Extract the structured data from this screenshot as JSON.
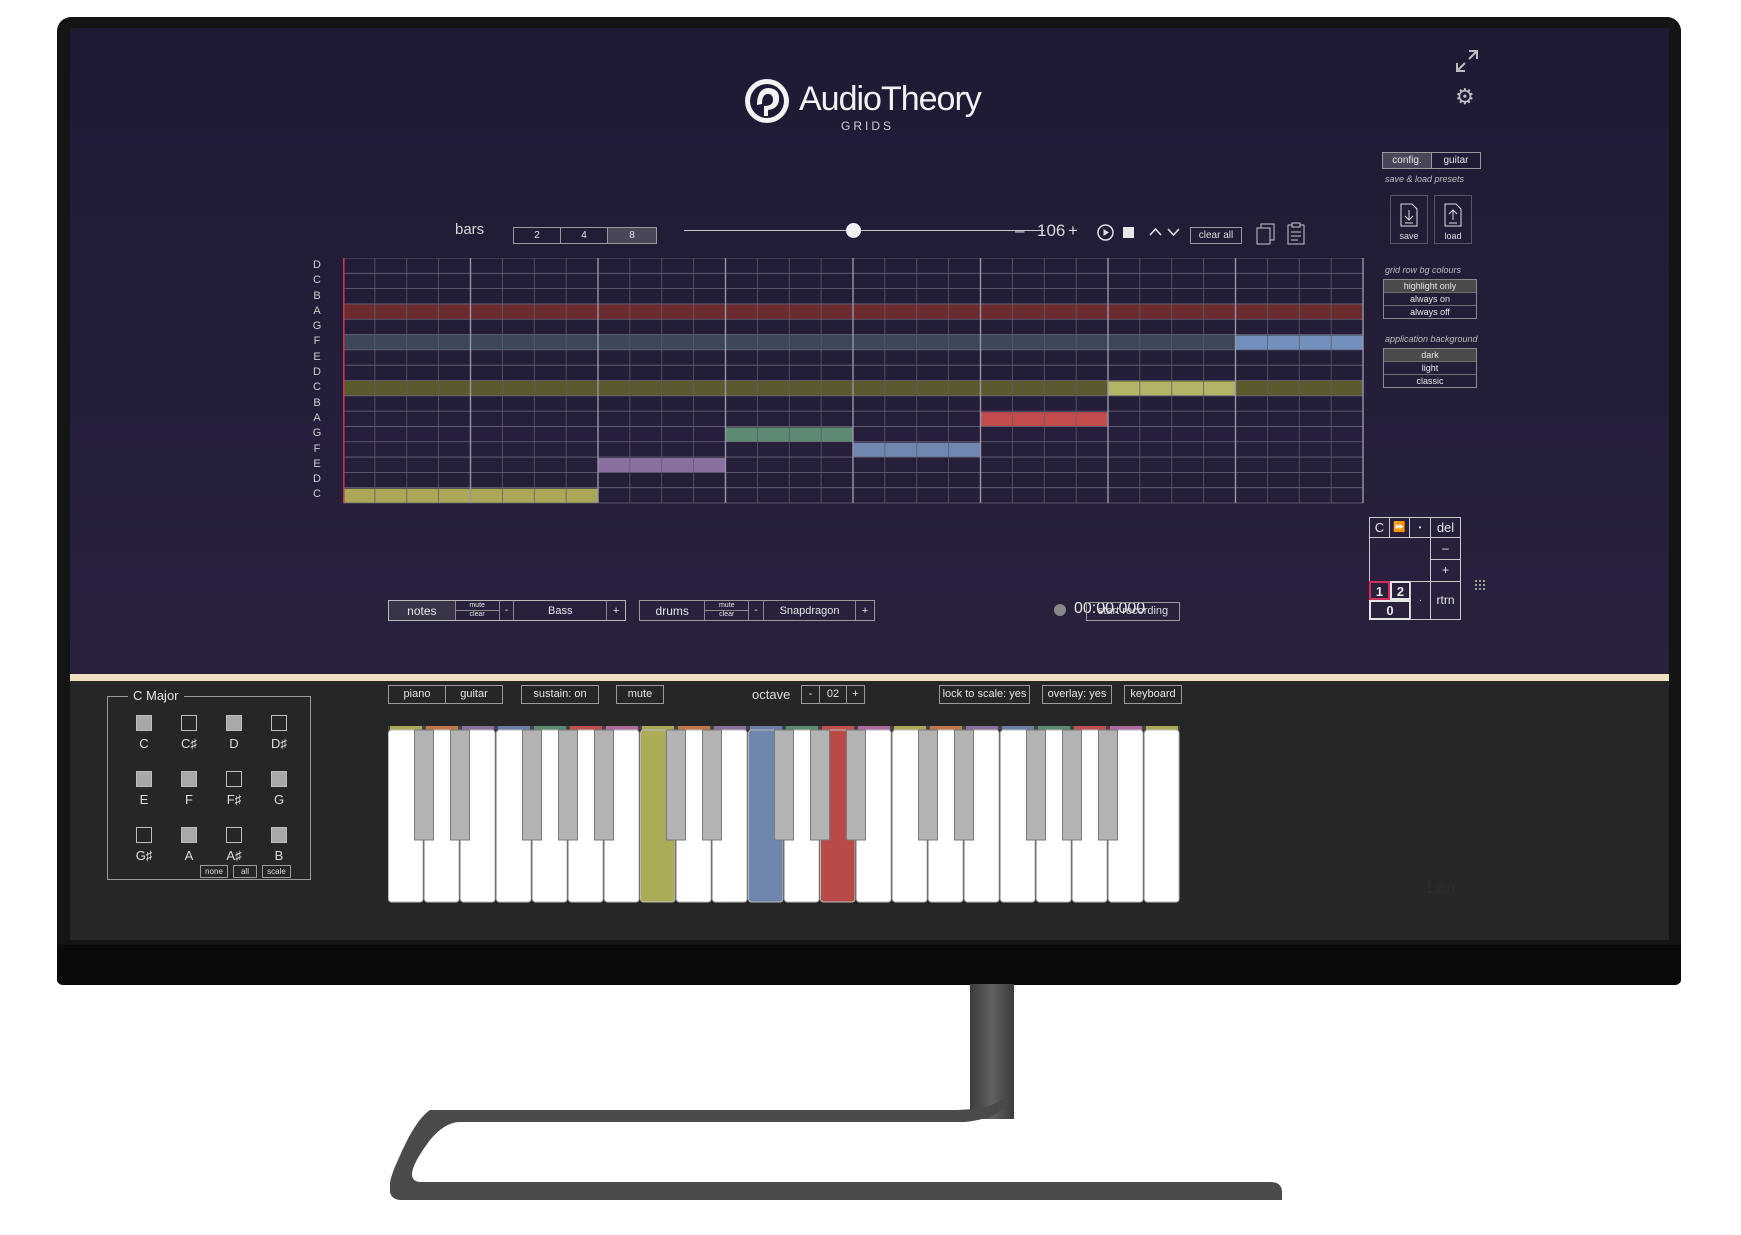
{
  "app": {
    "logo_title": "AudioTheory",
    "logo_subtitle": "GRIDS"
  },
  "toolbar": {
    "bars_label": "bars",
    "bars_options": [
      "2",
      "4",
      "8"
    ],
    "bars_selected": "8",
    "tempo_minus": "–",
    "tempo_value": "106",
    "tempo_plus": "+",
    "clear_all_label": "clear all"
  },
  "grid": {
    "row_labels": [
      "D",
      "C",
      "B",
      "A",
      "G",
      "F",
      "E",
      "D",
      "C",
      "B",
      "A",
      "G",
      "F",
      "E",
      "D",
      "C"
    ],
    "columns": 32,
    "highlight_rows": [
      {
        "row": 3,
        "color": "#6a2b2e"
      },
      {
        "row": 5,
        "color": "#3b4658"
      },
      {
        "row": 8,
        "color": "#5a5a2e"
      }
    ],
    "notes": [
      {
        "row": 15,
        "start": 0,
        "length": 8,
        "color": "#aaa858"
      },
      {
        "row": 13,
        "start": 8,
        "length": 4,
        "color": "#8a70a0"
      },
      {
        "row": 11,
        "start": 12,
        "length": 4,
        "color": "#5c8a72"
      },
      {
        "row": 12,
        "start": 16,
        "length": 4,
        "color": "#6f87b0"
      },
      {
        "row": 10,
        "start": 20,
        "length": 4,
        "color": "#c24d4d"
      },
      {
        "row": 8,
        "start": 24,
        "length": 4,
        "color": "#b3b466"
      },
      {
        "row": 5,
        "start": 28,
        "length": 4,
        "color": "#7390bc"
      }
    ]
  },
  "tracks": {
    "notes": {
      "label": "notes",
      "mute": "mute",
      "clear": "clear",
      "minus": "-",
      "instrument": "Bass",
      "plus": "+"
    },
    "drums": {
      "label": "drums",
      "mute": "mute",
      "clear": "clear",
      "minus": "-",
      "instrument": "Snapdragon",
      "plus": "+"
    }
  },
  "recording": {
    "time": "00:00.000",
    "start_label": "start recording"
  },
  "side_panel": {
    "tabs": [
      "config.",
      "guitar"
    ],
    "presets_label": "save & load presets",
    "save_label": "save",
    "load_label": "load",
    "grid_row_label": "grid row bg colours",
    "grid_row_options": [
      "highlight only",
      "always on",
      "always off"
    ],
    "grid_row_selected": "highlight only",
    "app_bg_label": "application background",
    "app_bg_options": [
      "dark",
      "light",
      "classic"
    ],
    "app_bg_selected": "dark"
  },
  "keypad": {
    "c": "C",
    "ff": "⏩",
    "dot_top": "•",
    "del": "del",
    "minus": "–",
    "plus": "+",
    "one": "1",
    "two": "2",
    "zero": "0",
    "dot": "·",
    "rtrn": "rtrn"
  },
  "scale": {
    "title": "C Major",
    "notes": [
      {
        "name": "C",
        "on": true
      },
      {
        "name": "C♯",
        "on": false
      },
      {
        "name": "D",
        "on": true
      },
      {
        "name": "D♯",
        "on": false
      },
      {
        "name": "E",
        "on": true
      },
      {
        "name": "F",
        "on": true
      },
      {
        "name": "F♯",
        "on": false
      },
      {
        "name": "G",
        "on": true
      },
      {
        "name": "G♯",
        "on": false
      },
      {
        "name": "A",
        "on": true
      },
      {
        "name": "A♯",
        "on": false
      },
      {
        "name": "B",
        "on": true
      }
    ],
    "none_label": "none",
    "all_label": "all",
    "scale_label": "scale"
  },
  "keyboard_controls": {
    "piano_label": "piano",
    "guitar_label": "guitar",
    "sustain_label": "sustain: on",
    "mute_label": "mute",
    "octave_label": "octave",
    "octave_minus": "-",
    "octave_value": "02",
    "octave_plus": "+",
    "lock_label": "lock to scale: yes",
    "overlay_label": "overlay: yes",
    "keyboard_label": "keyboard"
  },
  "piano": {
    "white_keys": 22,
    "highlighted_white": [
      {
        "index": 7,
        "color": "#abab58"
      },
      {
        "index": 10,
        "color": "#6e85ad"
      },
      {
        "index": 12,
        "color": "#b84a47"
      }
    ],
    "strip_colors": [
      "#aaa858",
      "#c07a4a",
      "#8a70a0",
      "#6a7fa8",
      "#5c8a72",
      "#c24d4d",
      "#b06aa0"
    ]
  },
  "version": "1.0.0"
}
